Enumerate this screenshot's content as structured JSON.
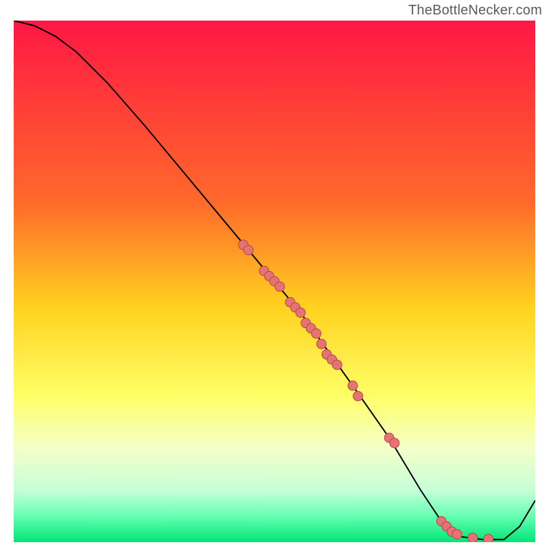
{
  "attribution": "TheBottleNecker.com",
  "chart_data": {
    "type": "line",
    "title": "",
    "xlabel": "",
    "ylabel": "",
    "xlim": [
      0,
      100
    ],
    "ylim": [
      0,
      100
    ],
    "gradient_stops": [
      {
        "offset": 0,
        "color": "#ff1744"
      },
      {
        "offset": 0.35,
        "color": "#ff6a2a"
      },
      {
        "offset": 0.55,
        "color": "#ffd21f"
      },
      {
        "offset": 0.72,
        "color": "#ffff66"
      },
      {
        "offset": 0.82,
        "color": "#f4ffc9"
      },
      {
        "offset": 0.9,
        "color": "#c6ffd6"
      },
      {
        "offset": 0.95,
        "color": "#66ffb3"
      },
      {
        "offset": 1.0,
        "color": "#00e676"
      }
    ],
    "series": [
      {
        "name": "bottleneck-curve",
        "color": "#000000",
        "x": [
          0,
          4,
          8,
          12,
          18,
          25,
          35,
          45,
          55,
          65,
          72,
          78,
          82,
          86,
          90,
          94,
          97,
          100
        ],
        "y": [
          100,
          99,
          97,
          94,
          88,
          80,
          68,
          56,
          44,
          30,
          20,
          10,
          4,
          1,
          0.5,
          0.5,
          3,
          8
        ]
      }
    ],
    "markers": {
      "name": "data-points",
      "color": "#e57373",
      "stroke": "#b24747",
      "r": 7,
      "points": [
        {
          "x": 44,
          "y": 57
        },
        {
          "x": 45,
          "y": 56
        },
        {
          "x": 48,
          "y": 52
        },
        {
          "x": 49,
          "y": 51
        },
        {
          "x": 50,
          "y": 50
        },
        {
          "x": 51,
          "y": 49
        },
        {
          "x": 53,
          "y": 46
        },
        {
          "x": 54,
          "y": 45
        },
        {
          "x": 55,
          "y": 44
        },
        {
          "x": 56,
          "y": 42
        },
        {
          "x": 57,
          "y": 41
        },
        {
          "x": 58,
          "y": 40
        },
        {
          "x": 59,
          "y": 38
        },
        {
          "x": 60,
          "y": 36
        },
        {
          "x": 61,
          "y": 35
        },
        {
          "x": 62,
          "y": 34
        },
        {
          "x": 65,
          "y": 30
        },
        {
          "x": 66,
          "y": 28
        },
        {
          "x": 72,
          "y": 20
        },
        {
          "x": 73,
          "y": 19
        },
        {
          "x": 82,
          "y": 4
        },
        {
          "x": 83,
          "y": 3
        },
        {
          "x": 84,
          "y": 2
        },
        {
          "x": 85,
          "y": 1.5
        },
        {
          "x": 88,
          "y": 0.8
        },
        {
          "x": 91,
          "y": 0.6
        }
      ]
    }
  }
}
